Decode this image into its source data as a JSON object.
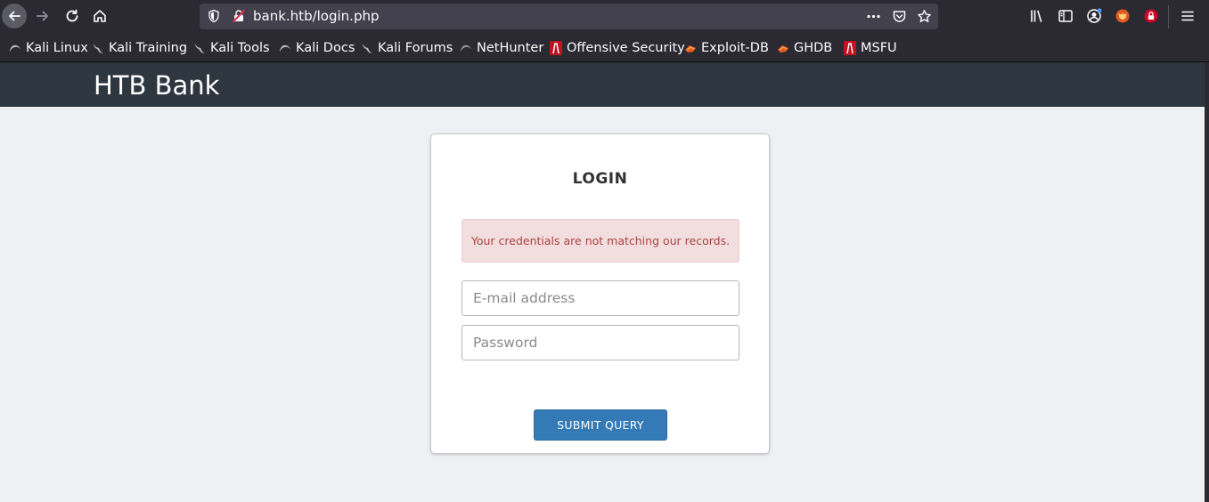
{
  "browser": {
    "url": "bank.htb/login.php",
    "bookmarks": [
      {
        "label": "Kali Linux",
        "icon": "kali-dragon-icon"
      },
      {
        "label": "Kali Training",
        "icon": "kali-dragon-icon"
      },
      {
        "label": "Kali Tools",
        "icon": "kali-dragon-icon"
      },
      {
        "label": "Kali Docs",
        "icon": "kali-dragon-icon"
      },
      {
        "label": "Kali Forums",
        "icon": "kali-dragon-icon"
      },
      {
        "label": "NetHunter",
        "icon": "kali-dragon-icon"
      },
      {
        "label": "Offensive Security",
        "icon": "offsec-icon"
      },
      {
        "label": "Exploit-DB",
        "icon": "exploitdb-icon"
      },
      {
        "label": "GHDB",
        "icon": "exploitdb-icon"
      },
      {
        "label": "MSFU",
        "icon": "offsec-icon"
      }
    ],
    "colors": {
      "chrome_bg": "#2b2a33",
      "urlbar_bg": "#42414d",
      "text": "#fbfbfe"
    }
  },
  "site": {
    "brand": "HTB Bank",
    "navbar_color": "#2e3640"
  },
  "login": {
    "title": "LOGIN",
    "error_message": "Your credentials are not matching our records.",
    "email_placeholder": "E-mail address",
    "email_value": "",
    "password_placeholder": "Password",
    "password_value": "",
    "submit_label": "SUBMIT QUERY",
    "colors": {
      "alert_bg": "#f2dede",
      "alert_text": "#a94442",
      "button": "#337ab7"
    }
  }
}
